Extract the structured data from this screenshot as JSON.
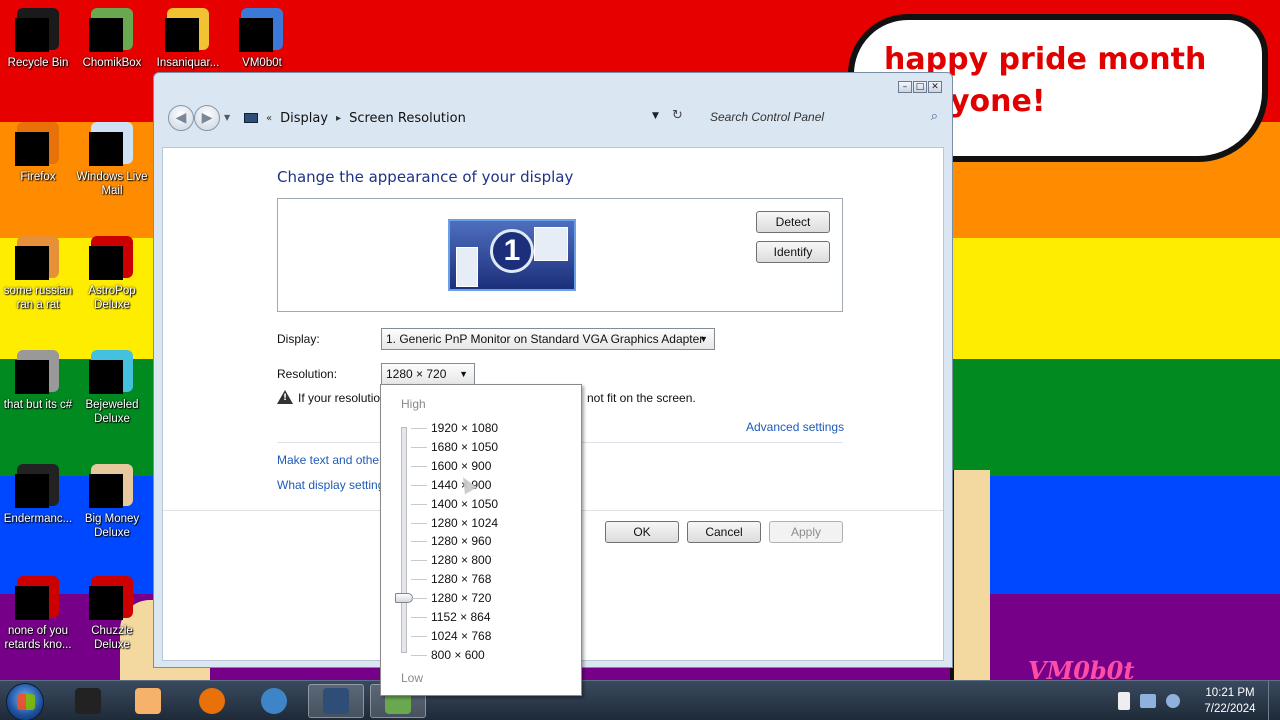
{
  "desktop": {
    "bubble": {
      "line1": "happy pride month",
      "line2": "yone!"
    },
    "watermark": "VM0b0t",
    "icons": [
      {
        "label": "Recycle Bin",
        "icon": "recycle-bin-icon",
        "color": "#1a1a1a"
      },
      {
        "label": "ChomikBox",
        "icon": "chomikbox-icon",
        "color": "#6aa84f"
      },
      {
        "label": "Insaniquar...",
        "icon": "insaniquarium-icon",
        "color": "#f1c232"
      },
      {
        "label": "VM0b0t",
        "icon": "vm0b0t-icon",
        "color": "#3c78d8"
      },
      {
        "label": "Firefox",
        "icon": "firefox-icon",
        "color": "#e8710a"
      },
      {
        "label": "Windows Live Mail",
        "icon": "mail-icon",
        "color": "#cfe2f3"
      },
      {
        "label": "some russian ran a rat",
        "icon": "ie-icon",
        "color": "#e69138"
      },
      {
        "label": "AstroPop Deluxe",
        "icon": "astropop-icon",
        "color": "#cc0000"
      },
      {
        "label": "that but its c#",
        "icon": "window-icon",
        "color": "#999999"
      },
      {
        "label": "Bejeweled Deluxe",
        "icon": "bejeweled-icon",
        "color": "#45c1e0"
      },
      {
        "label": "Endermanc...",
        "icon": "enderman-icon",
        "color": "#222222"
      },
      {
        "label": "Big Money Deluxe",
        "icon": "big-money-icon",
        "color": "#e7c9a0"
      },
      {
        "label": "none of you retards kno...",
        "icon": "red-ball-icon",
        "color": "#cc0000"
      },
      {
        "label": "Chuzzle Deluxe",
        "icon": "chuzzle-icon",
        "color": "#cc0000"
      }
    ]
  },
  "window": {
    "breadcrumb": {
      "item1": "Display",
      "item2": "Screen Resolution"
    },
    "search_placeholder": "Search Control Panel",
    "heading": "Change the appearance of your display",
    "monitor_number": "1",
    "detect_label": "Detect",
    "identify_label": "Identify",
    "display_label": "Display:",
    "display_value": "1. Generic PnP Monitor on Standard VGA Graphics Adapter",
    "resolution_label": "Resolution:",
    "resolution_value": "1280 × 720",
    "warning_text_start": "If your resolutio",
    "warning_text_end": "not fit on the screen.",
    "advanced_link": "Advanced settings",
    "link1": "Make text and other",
    "link2": "What display setting",
    "ok_label": "OK",
    "cancel_label": "Cancel",
    "apply_label": "Apply"
  },
  "dropdown": {
    "high_label": "High",
    "low_label": "Low",
    "selected": "1280 × 720",
    "options": [
      "1920 × 1080",
      "1680 × 1050",
      "1600 × 900",
      "1440 × 900",
      "1400 × 1050",
      "1280 × 1024",
      "1280 × 960",
      "1280 × 800",
      "1280 × 768",
      "1280 × 720",
      "1152 × 864",
      "1024 × 768",
      "800 × 600"
    ]
  },
  "taskbar": {
    "time": "10:21 PM",
    "date": "7/22/2024",
    "apps": [
      {
        "icon": "cmd-icon",
        "color": "#222222"
      },
      {
        "icon": "media-player-icon",
        "color": "#f6b26b"
      },
      {
        "icon": "firefox-icon",
        "color": "#e8710a"
      },
      {
        "icon": "globe-icon",
        "color": "#3d85c6"
      },
      {
        "icon": "display-icon",
        "color": "#2e4e78"
      },
      {
        "icon": "checkmark-icon",
        "color": "#6aa84f"
      }
    ]
  }
}
